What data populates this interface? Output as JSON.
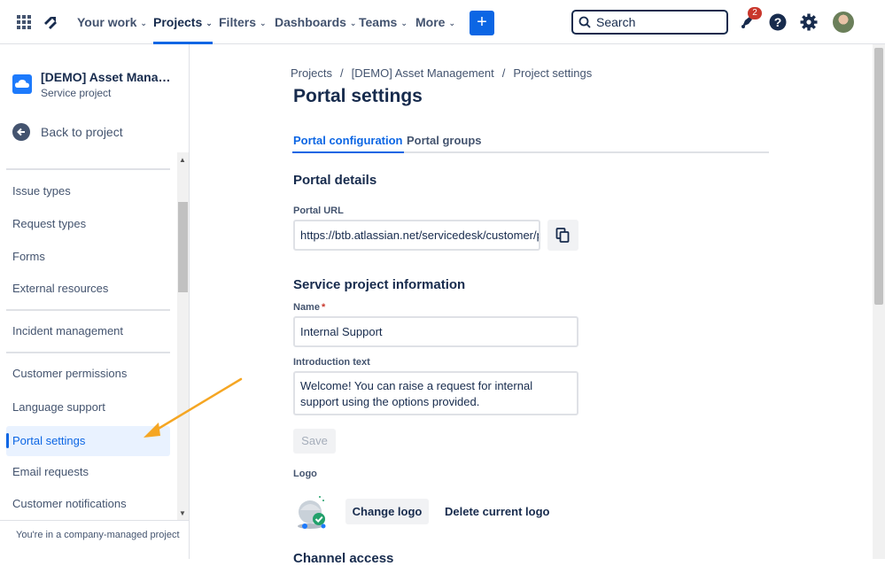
{
  "topnav": {
    "items": [
      {
        "label": "Your work"
      },
      {
        "label": "Projects"
      },
      {
        "label": "Filters"
      },
      {
        "label": "Dashboards"
      },
      {
        "label": "Teams"
      },
      {
        "label": "More"
      }
    ],
    "create_label": "+",
    "search_placeholder": "Search",
    "notification_count": "2",
    "accent_color": "#0c66e4"
  },
  "sidebar": {
    "project_name": "[DEMO] Asset Management",
    "project_type": "Service project",
    "back_label": "Back to project",
    "items": [
      {
        "label": "Issue types"
      },
      {
        "label": "Request types"
      },
      {
        "label": "Forms"
      },
      {
        "label": "External resources"
      },
      {
        "label": "Incident management"
      },
      {
        "label": "Customer permissions"
      },
      {
        "label": "Language support"
      },
      {
        "label": "Portal settings"
      },
      {
        "label": "Email requests"
      },
      {
        "label": "Customer notifications"
      }
    ],
    "footer": "You're in a company-managed project"
  },
  "breadcrumb": [
    "Projects",
    "[DEMO] Asset Management",
    "Project settings"
  ],
  "page_title": "Portal settings",
  "tabs": [
    {
      "label": "Portal configuration"
    },
    {
      "label": "Portal groups"
    }
  ],
  "portal_details": {
    "heading": "Portal details",
    "url_label": "Portal URL",
    "url_value": "https://btb.atlassian.net/servicedesk/customer/p"
  },
  "project_info": {
    "heading": "Service project information",
    "name_label": "Name",
    "name_required_mark": "*",
    "name_value": "Internal Support",
    "intro_label": "Introduction text",
    "intro_value": "Welcome! You can raise a request for internal support using the options provided.",
    "save_label": "Save"
  },
  "logo": {
    "label": "Logo",
    "change_label": "Change logo",
    "delete_label": "Delete current logo"
  },
  "next_section_heading": "Channel access"
}
